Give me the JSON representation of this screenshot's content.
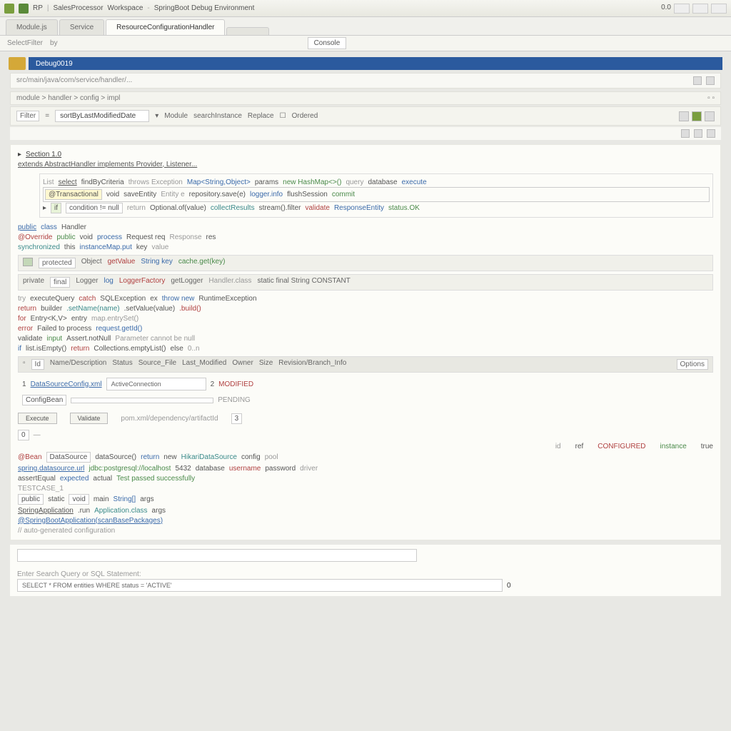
{
  "titlebar": {
    "app": "RP",
    "doc1": "SalesProcessor",
    "doc2": "Workspace",
    "doc3": "SpringBoot Debug Environment",
    "right": "0.0"
  },
  "tabs": [
    {
      "label": "Module.js"
    },
    {
      "label": "Service"
    },
    {
      "label": "ResourceConfigurationHandler"
    },
    {
      "label": ""
    }
  ],
  "toolbar": {
    "item1": "SelectFilter",
    "item2": "by",
    "console": "Console"
  },
  "banner": "Debug0019",
  "breadcrumb": "src/main/java/com/service/handler/...",
  "filterbar": {
    "label1": "Filter",
    "select1": "sortByLastModifiedDate",
    "label2": "Module",
    "label3": "searchInstance",
    "label4": "Replace",
    "chk1": "Ordered"
  },
  "header": {
    "line1": "Section 1.0",
    "line2": "extends AbstractHandler implements Provider, Listener..."
  },
  "codebox": {
    "r1": {
      "a": "List",
      "b": "select",
      "c": "findByCriteria",
      "d": "throws Exception",
      "e": "Map<String,Object>",
      "f": "params",
      "g": "new HashMap<>()",
      "h": "query",
      "i": "database",
      "j": "execute"
    },
    "r2": {
      "a": "@Transactional",
      "b": "void",
      "c": "saveEntity",
      "d": "Entity e",
      "e": "repository.save(e)",
      "f": "logger.info",
      "g": "flushSession",
      "h": "commit"
    },
    "r3": {
      "a": "if",
      "b": "condition != null",
      "c": "return",
      "d": "Optional.of(value)",
      "e": "collectResults",
      "f": "stream().filter",
      "g": "validate",
      "h": "ResponseEntity",
      "i": "status.OK"
    }
  },
  "mid": {
    "label1": "public",
    "label2": "class",
    "label3": "Handler",
    "r1": {
      "a": "@Override",
      "b": "public",
      "c": "void",
      "d": "process",
      "e": "Request req",
      "f": "Response",
      "g": "res"
    },
    "r2": {
      "a": "synchronized",
      "b": "this",
      "c": "instanceMap.put",
      "d": "key",
      "e": "value"
    },
    "bar1": {
      "a": "protected",
      "b": "Object",
      "c": "getValue",
      "d": "String key",
      "e": "cache.get(key)"
    },
    "bar2": {
      "a": "private",
      "b": "final",
      "c": "Logger",
      "d": "log",
      "e": "LoggerFactory",
      "f": "getLogger",
      "g": "Handler.class",
      "h": "static final String CONSTANT"
    },
    "r3": {
      "a": "try",
      "b": "executeQuery",
      "c": "catch",
      "d": "SQLException",
      "e": "ex",
      "f": "throw new",
      "g": "RuntimeException"
    },
    "r4": {
      "a": "return",
      "b": "builder",
      "c": ".setName(name)",
      "d": ".setValue(value)",
      "e": ".build()"
    },
    "r5": {
      "a": "for",
      "b": "Entry<K,V>",
      "c": "entry",
      "d": "map.entrySet()"
    },
    "r6": {
      "a": "error",
      "b": "Failed to process",
      "c": "request.getId()"
    },
    "r7": {
      "a": "validate",
      "b": "input",
      "c": "Assert.notNull",
      "d": "Parameter cannot be null"
    },
    "r8": {
      "a": "if",
      "b": "list.isEmpty()",
      "c": "return",
      "d": "Collections.emptyList()",
      "e": "else",
      "f": "0..n"
    }
  },
  "tablebar": {
    "c1": "Id",
    "c2": "Name/Description",
    "c3": "Status",
    "c4": "Source_File",
    "c5": "Last_Modified",
    "c6": "Owner",
    "c7": "Size",
    "c8": "Revision/Branch_Info",
    "right": "Options"
  },
  "tr1": {
    "a": "1",
    "b": "DataSourceConfig.xml",
    "c": "ActiveConnection",
    "d": "",
    "e": "2",
    "f": "MODIFIED"
  },
  "tr2": {
    "a": "ConfigBean",
    "b": "",
    "c": "PENDING"
  },
  "buttons": {
    "b1": "Execute",
    "b2": "Validate",
    "b3": "pom.xml/dependency/artifactId",
    "b4": "3",
    "b5": "0"
  },
  "lower": {
    "r1": {
      "a": "id",
      "b": "",
      "c": "ref",
      "d": "CONFIGURED",
      "e": "instance",
      "f": "true"
    },
    "r2": {
      "a": "@Bean",
      "b": "DataSource",
      "c": "dataSource()",
      "d": "return",
      "e": "new",
      "f": "HikariDataSource",
      "g": "config",
      "h": "pool"
    },
    "r3": {
      "a": "spring.datasource.url",
      "b": "jdbc:postgresql://localhost",
      "c": "5432",
      "d": "database",
      "e": "username",
      "f": "password",
      "g": "driver"
    },
    "r4": {
      "a": "assertEqual",
      "b": "expected",
      "c": "actual",
      "d": "Test passed successfully"
    },
    "r5": "TESTCASE_1",
    "r6": {
      "a": "public",
      "b": "static",
      "c": "void",
      "d": "main",
      "e": "String[]",
      "f": "args"
    },
    "r7": {
      "a": "SpringApplication",
      "b": ".run",
      "c": "Application.class",
      "d": "args"
    },
    "r8": "@SpringBootApplication(scanBasePackages)",
    "r9": "// auto-generated configuration"
  },
  "bottom": {
    "label": "Enter Search Query or SQL Statement:",
    "input": "SELECT * FROM entities WHERE status = 'ACTIVE'",
    "val": "0"
  }
}
